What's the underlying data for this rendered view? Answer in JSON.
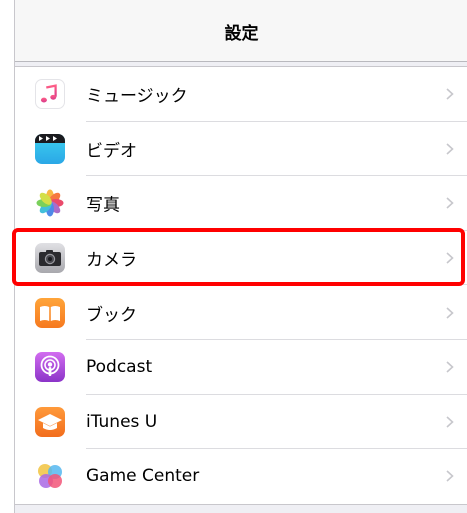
{
  "navbar": {
    "title": "設定"
  },
  "items": [
    {
      "label": "ミュージック",
      "icon": "music-icon"
    },
    {
      "label": "ビデオ",
      "icon": "video-icon"
    },
    {
      "label": "写真",
      "icon": "photos-icon"
    },
    {
      "label": "カメラ",
      "icon": "camera-icon"
    },
    {
      "label": "ブック",
      "icon": "books-icon"
    },
    {
      "label": "Podcast",
      "icon": "podcast-icon"
    },
    {
      "label": "iTunes U",
      "icon": "itunes-u-icon"
    },
    {
      "label": "Game Center",
      "icon": "game-center-icon"
    }
  ],
  "highlight": {
    "target": "カメラ",
    "color": "#ff0000"
  },
  "colors": {
    "background": "#efeff4",
    "separator": "#c8c7cc",
    "chevron": "#c7c7cc"
  }
}
